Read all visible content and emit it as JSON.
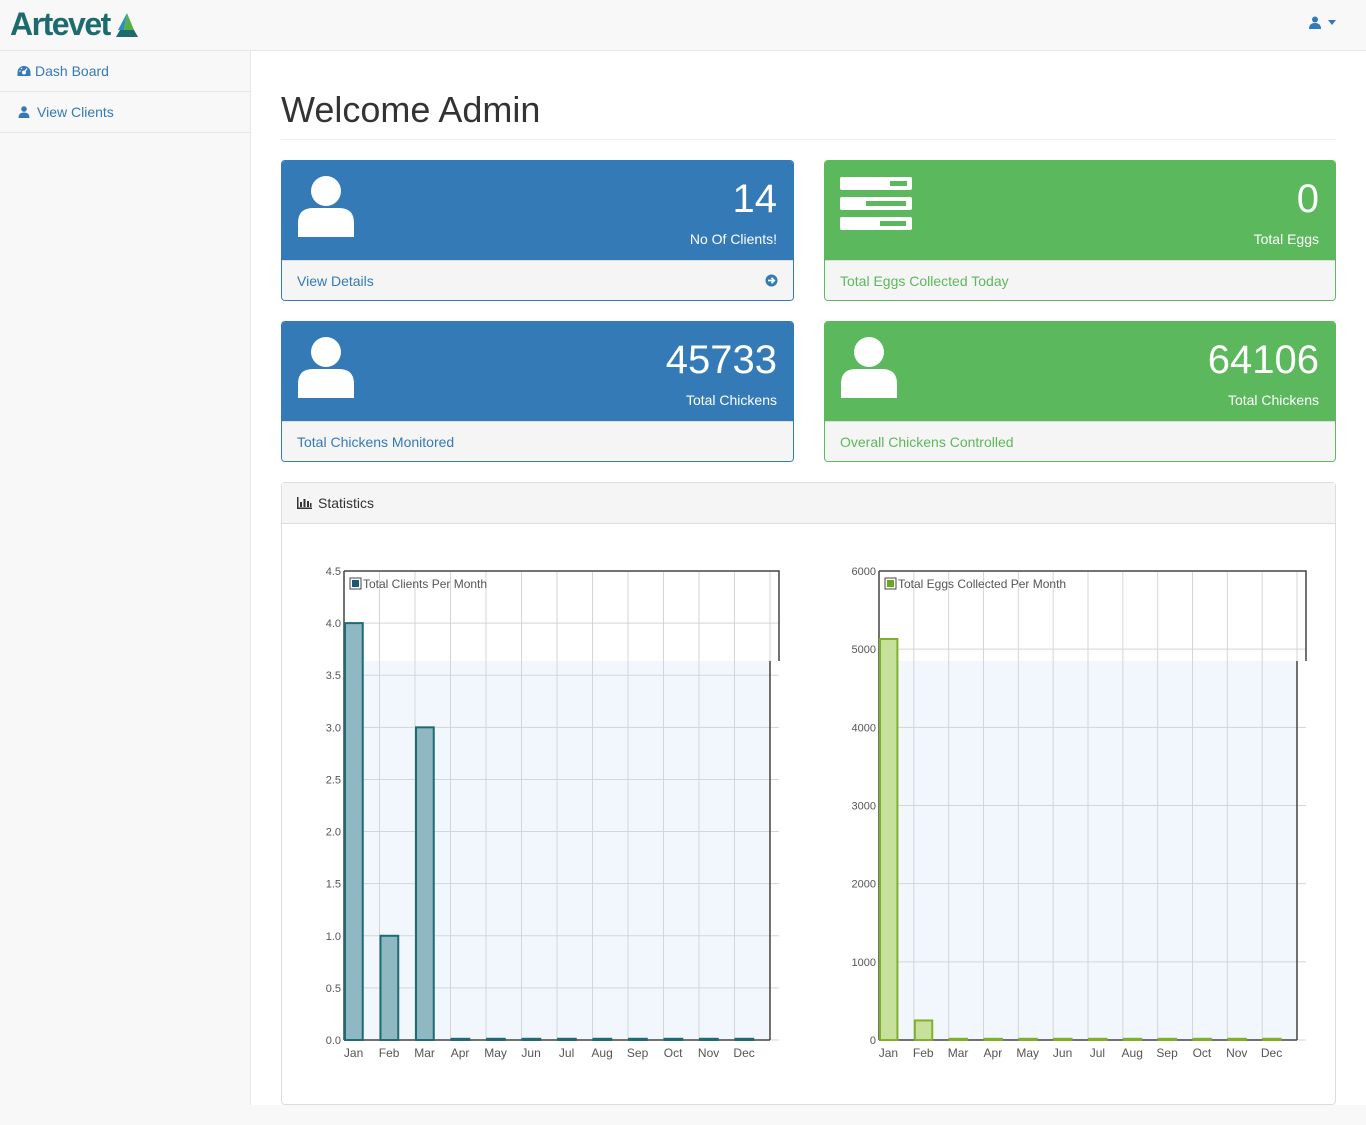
{
  "brand": {
    "name": "Artevet"
  },
  "nav": {
    "user_icon": "user-icon"
  },
  "sidebar": {
    "items": [
      {
        "label": "Dash Board",
        "icon": "dashboard-icon"
      },
      {
        "label": "View Clients",
        "icon": "user-icon"
      }
    ]
  },
  "page": {
    "title": "Welcome Admin"
  },
  "cards": [
    {
      "value": "14",
      "label": "No Of Clients!",
      "footer": "View Details",
      "icon": "user-icon",
      "color": "#337ab7"
    },
    {
      "value": "0",
      "label": "Total Eggs",
      "footer": "Total Eggs Collected Today",
      "icon": "tasks-icon",
      "color": "#5cb85c"
    },
    {
      "value": "45733",
      "label": "Total Chickens",
      "footer": "Total Chickens Monitored",
      "icon": "user-icon",
      "color": "#337ab7"
    },
    {
      "value": "64106",
      "label": "Total Chickens",
      "footer": "Overall Chickens Controlled",
      "icon": "user-icon",
      "color": "#5cb85c"
    }
  ],
  "statistics": {
    "title": "Statistics"
  },
  "chart_data": [
    {
      "type": "bar",
      "categories": [
        "Jan",
        "Feb",
        "Mar",
        "Apr",
        "May",
        "Jun",
        "Jul",
        "Aug",
        "Sep",
        "Oct",
        "Nov",
        "Dec"
      ],
      "series": [
        {
          "name": "Total Clients Per Month",
          "values": [
            4,
            1,
            3,
            0,
            0,
            0,
            0,
            0,
            0,
            0,
            0,
            0
          ]
        }
      ],
      "ylim": [
        0,
        4.5
      ],
      "yticks": [
        "0.0",
        "0.5",
        "1.0",
        "1.5",
        "2.0",
        "2.5",
        "3.0",
        "3.5",
        "4.0",
        "4.5"
      ],
      "grid": true,
      "legend": "top-left",
      "bar_fill": "#8fb8c3",
      "bar_stroke": "#1d6b74"
    },
    {
      "type": "bar",
      "categories": [
        "Jan",
        "Feb",
        "Mar",
        "Apr",
        "May",
        "Jun",
        "Jul",
        "Aug",
        "Sep",
        "Oct",
        "Nov",
        "Dec"
      ],
      "series": [
        {
          "name": "Total Eggs Collected Per Month",
          "values": [
            5130,
            250,
            0,
            0,
            0,
            0,
            0,
            0,
            0,
            0,
            0,
            0
          ]
        }
      ],
      "ylim": [
        0,
        6000
      ],
      "yticks": [
        "0",
        "1000",
        "2000",
        "3000",
        "4000",
        "5000",
        "6000"
      ],
      "grid": true,
      "legend": "top-left",
      "bar_fill": "#c7e09a",
      "bar_stroke": "#7fb02a"
    }
  ]
}
